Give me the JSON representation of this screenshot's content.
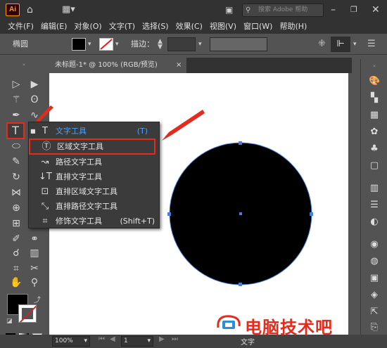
{
  "app": {
    "logo": "Ai"
  },
  "titlebar": {
    "search_placeholder": "搜索 Adobe 帮助"
  },
  "menu": [
    "文件(F)",
    "编辑(E)",
    "对象(O)",
    "文字(T)",
    "选择(S)",
    "效果(C)",
    "视图(V)",
    "窗口(W)",
    "帮助(H)"
  ],
  "control": {
    "shape_label": "椭圆",
    "stroke_label": "描边："
  },
  "tab": {
    "title": "未标题-1* @ 100% (RGB/预览)",
    "close": "×"
  },
  "flyout": {
    "header": {
      "label": "文字工具",
      "shortcut": "(T)"
    },
    "items": [
      {
        "label": "区域文字工具",
        "icon": "area-type-icon"
      },
      {
        "label": "路径文字工具",
        "icon": "type-on-path-icon"
      },
      {
        "label": "直排文字工具",
        "icon": "vertical-type-icon"
      },
      {
        "label": "直排区域文字工具",
        "icon": "vertical-area-type-icon"
      },
      {
        "label": "直排路径文字工具",
        "icon": "vertical-type-on-path-icon"
      },
      {
        "label": "修饰文字工具",
        "shortcut": "(Shift+T)",
        "icon": "touch-type-icon"
      }
    ]
  },
  "status": {
    "zoom": "100%",
    "page": "1",
    "footer_label": "文字"
  },
  "watermark": {
    "text": "电脑技术吧"
  },
  "colors": {
    "accent_red": "#e52b1e",
    "selection_blue": "#4a7fd9",
    "header_blue": "#4f9ff6"
  }
}
